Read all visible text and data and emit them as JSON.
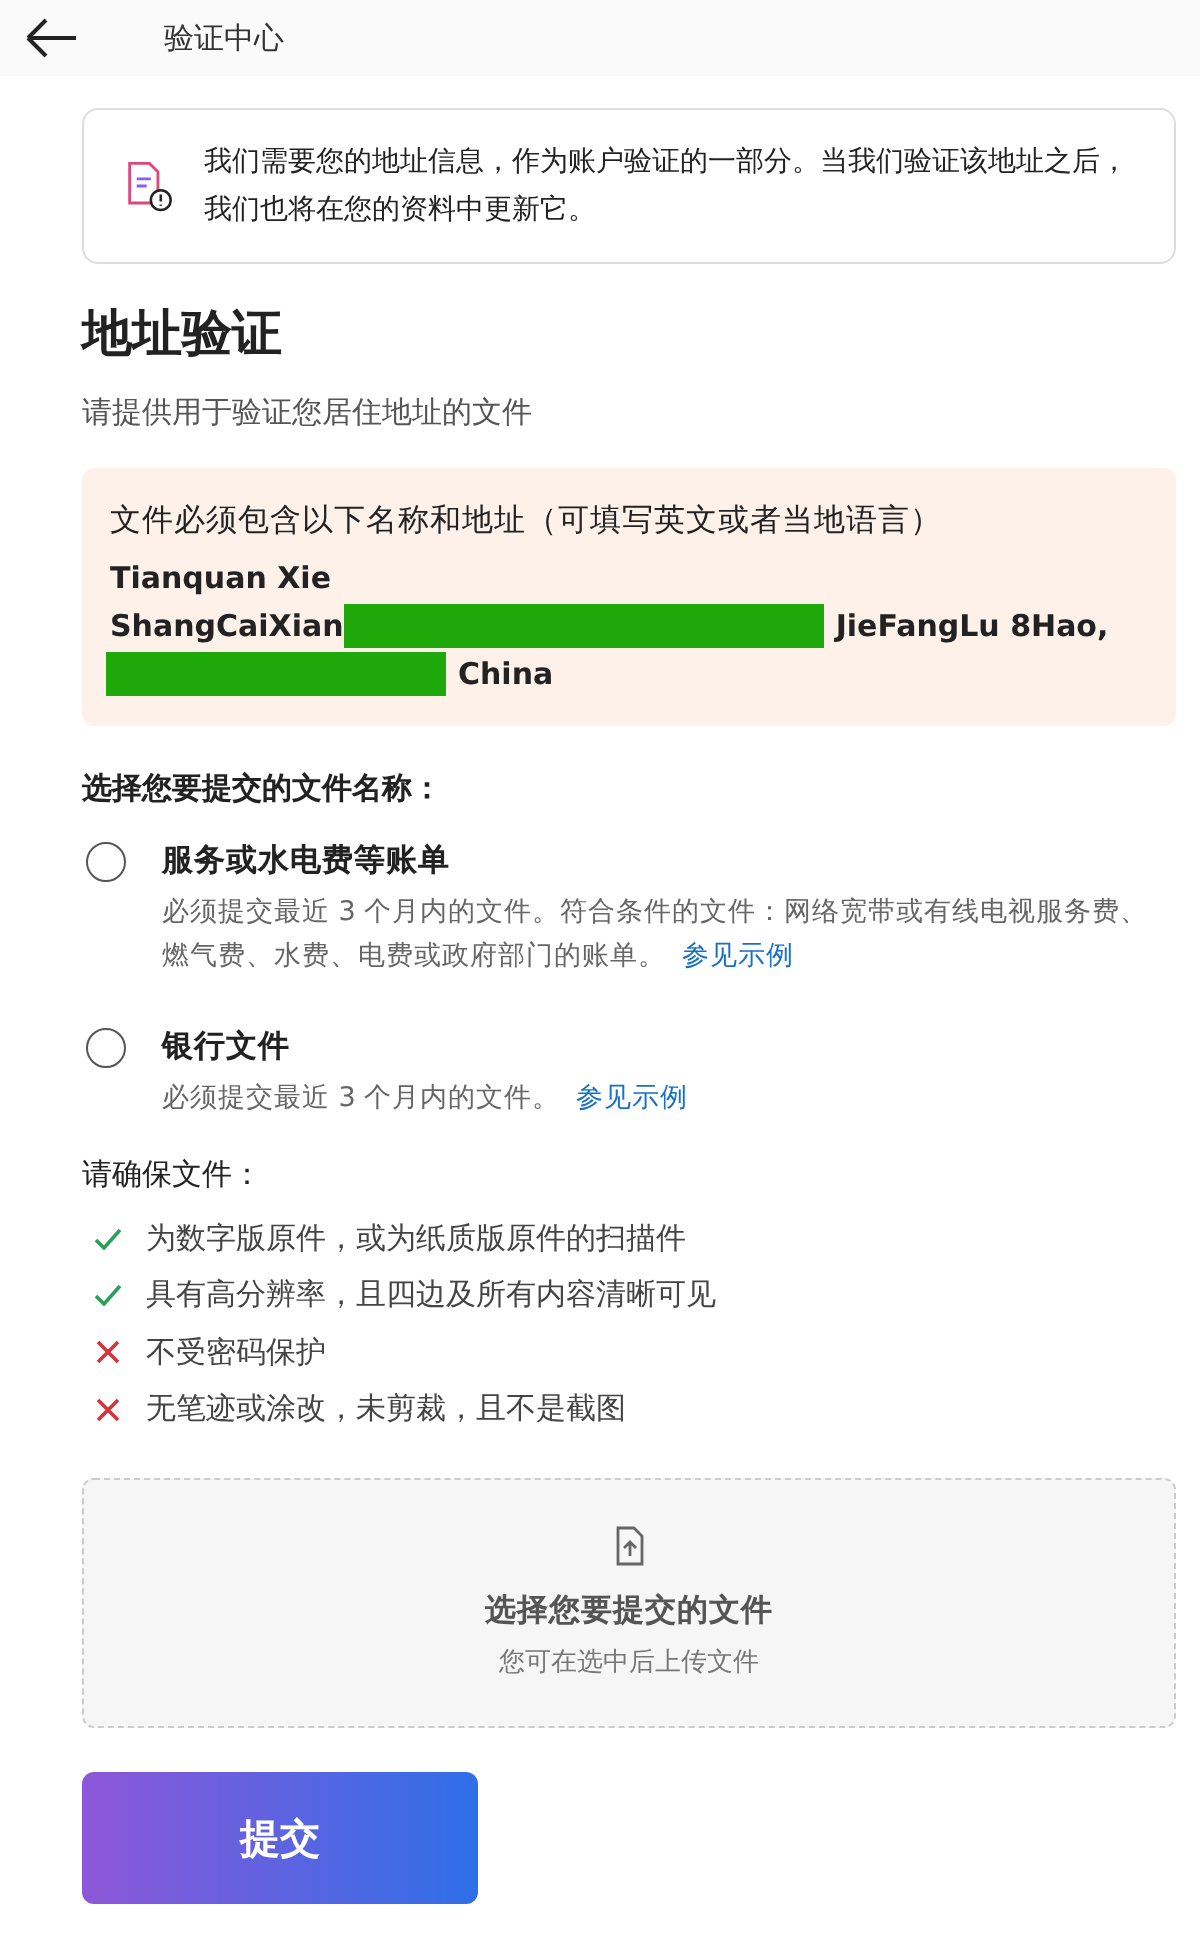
{
  "header": {
    "title": "验证中心"
  },
  "notice": {
    "text": "我们需要您的地址信息，作为账户验证的一部分。当我们验证该地址之后，我们也将在您的资料中更新它。"
  },
  "section": {
    "title": "地址验证",
    "subtitle": "请提供用于验证您居住地址的文件"
  },
  "address_box": {
    "heading": "文件必须包含以下名称和地址（可填写英文或者当地语言）",
    "lines": [
      [
        {
          "kind": "text",
          "text": "Tianquan Xie"
        }
      ],
      [
        {
          "kind": "text",
          "text": "ShangCaiXian"
        },
        {
          "kind": "redacted"
        },
        {
          "kind": "text",
          "text": "JieFangLu 8Hao,"
        }
      ],
      [
        {
          "kind": "redacted"
        },
        {
          "kind": "text",
          "text": "China"
        }
      ]
    ]
  },
  "choice_label": "选择您要提交的文件名称：",
  "options": [
    {
      "title": "服务或水电费等账单",
      "description": "必须提交最近 3 个月内的文件。符合条件的文件：网络宽带或有线电视服务费、燃气费、水费、电费或政府部门的账单。",
      "link": "参见示例",
      "selected": false
    },
    {
      "title": "银行文件",
      "description": "必须提交最近 3 个月内的文件。",
      "link": "参见示例",
      "selected": false
    }
  ],
  "requirements_label": "请确保文件：",
  "requirements": [
    {
      "text": "为数字版原件，或为纸质版原件的扫描件",
      "met": true
    },
    {
      "text": "具有高分辨率，且四边及所有内容清晰可见",
      "met": true
    },
    {
      "text": "不受密码保护",
      "met": false
    },
    {
      "text": "无笔迹或涂改，未剪裁，且不是截图",
      "met": false
    }
  ],
  "upload": {
    "title": "选择您要提交的文件",
    "hint": "您可在选中后上传文件"
  },
  "submit": "提交"
}
